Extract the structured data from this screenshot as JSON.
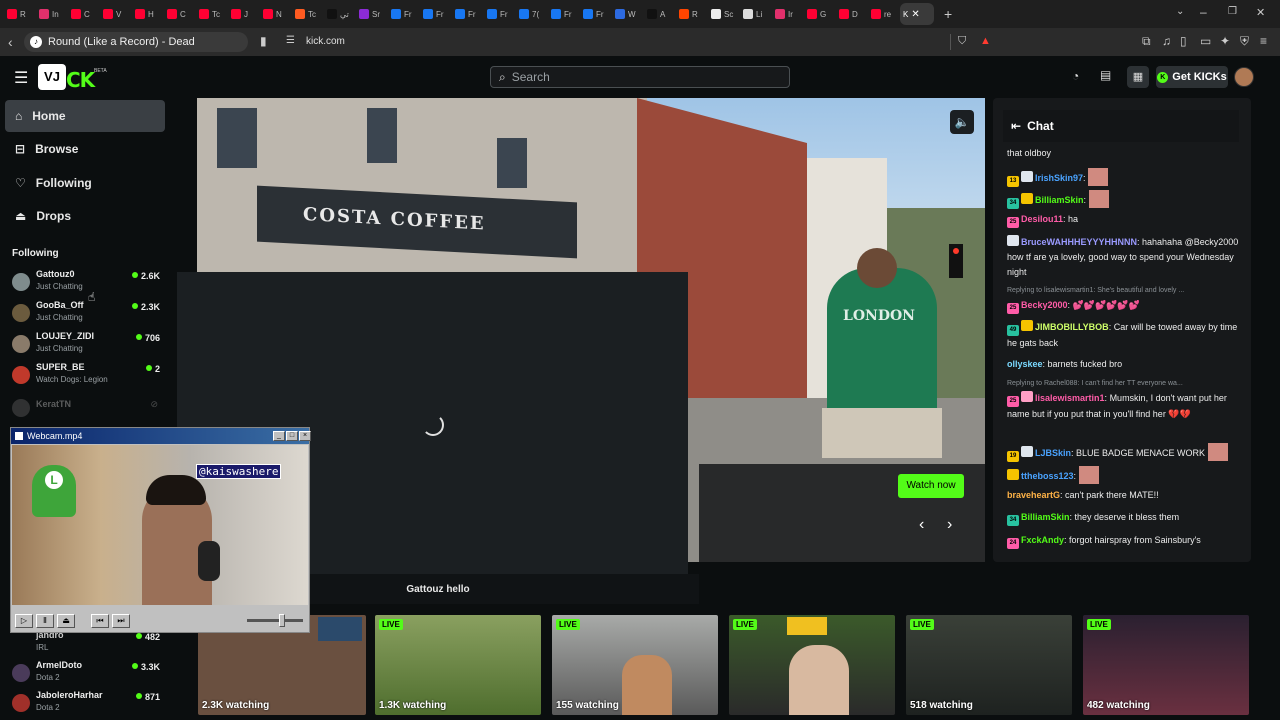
{
  "browser": {
    "tab_title": "Round (Like a Record) - Dead",
    "active_tab_label": "K",
    "url": "kick.com",
    "tabs": [
      {
        "label": "R",
        "color": "#ff0033"
      },
      {
        "label": "In",
        "color": "#e1306c"
      },
      {
        "label": "C",
        "color": "#ff0033"
      },
      {
        "label": "V",
        "color": "#ff0033"
      },
      {
        "label": "H",
        "color": "#ff0033"
      },
      {
        "label": "C",
        "color": "#ff0033"
      },
      {
        "label": "Tc",
        "color": "#ff0033"
      },
      {
        "label": "J",
        "color": "#ff0033"
      },
      {
        "label": "N",
        "color": "#ff0033"
      },
      {
        "label": "Tc",
        "color": "#ff5b21"
      },
      {
        "label": "تي",
        "color": "#111111"
      },
      {
        "label": "Sr",
        "color": "#8c2bd6"
      },
      {
        "label": "Fr",
        "color": "#1877f2"
      },
      {
        "label": "Fr",
        "color": "#1877f2"
      },
      {
        "label": "Fr",
        "color": "#1877f2"
      },
      {
        "label": "Fr",
        "color": "#1877f2"
      },
      {
        "label": "7(",
        "color": "#1877f2"
      },
      {
        "label": "Fr",
        "color": "#1877f2"
      },
      {
        "label": "Fr",
        "color": "#1877f2"
      },
      {
        "label": "W",
        "color": "#2d6ae0"
      },
      {
        "label": "A",
        "color": "#111111"
      },
      {
        "label": "R",
        "color": "#ff4500"
      },
      {
        "label": "Sc",
        "color": "#eeeeee"
      },
      {
        "label": "Li",
        "color": "#dddddd"
      },
      {
        "label": "Ir",
        "color": "#e1306c"
      },
      {
        "label": "G",
        "color": "#ff0033"
      },
      {
        "label": "D",
        "color": "#ff0033"
      },
      {
        "label": "re",
        "color": "#ff0033"
      }
    ]
  },
  "header": {
    "search_placeholder": "Search",
    "get_kicks": "Get KICKs",
    "logo_beta": "BETA"
  },
  "sidebar": {
    "nav": [
      {
        "label": "Home",
        "icon": "home-icon"
      },
      {
        "label": "Browse",
        "icon": "browse-icon"
      },
      {
        "label": "Following",
        "icon": "heart-icon"
      },
      {
        "label": "Drops",
        "icon": "drops-icon"
      }
    ],
    "following_heading": "Following",
    "following": [
      {
        "name": "Gattouz0",
        "category": "Just Chatting",
        "viewers": "2.6K",
        "color": "#7f8c8d"
      },
      {
        "name": "GooBa_Off",
        "category": "Just Chatting",
        "viewers": "2.3K",
        "color": "#6b5b3e"
      },
      {
        "name": "LOUJEY_ZIDI",
        "category": "Just Chatting",
        "viewers": "706",
        "color": "#8a7b6a"
      },
      {
        "name": "SUPER_BE",
        "category": "Watch Dogs: Legion",
        "viewers": "2",
        "color": "#c0392b"
      },
      {
        "name": "KeratTN",
        "category": "",
        "viewers": "",
        "color": "#555555"
      }
    ],
    "bottom_following": [
      {
        "name": "jandro",
        "category": "IRL",
        "viewers": "482"
      },
      {
        "name": "ArmelDoto",
        "category": "Dota 2",
        "viewers": "3.3K"
      },
      {
        "name": "JaboleroHarhar",
        "category": "Dota 2",
        "viewers": "871"
      }
    ]
  },
  "featured": {
    "watch_now": "Watch now",
    "loader_caption": "Gattouz hello",
    "storefront_text": "COSTA COFFEE",
    "shirt_text": "LONDON"
  },
  "chat": {
    "title": "Chat",
    "messages": [
      {
        "user": "",
        "text": "that oldboy",
        "color": "#ffffff"
      },
      {
        "user": "IrishSkin97",
        "text": "",
        "color": "#4aa3ff",
        "badge": "13"
      },
      {
        "user": "BilliamSkin",
        "text": "",
        "color": "#53fc18",
        "badge": "34"
      },
      {
        "user": "Desilou11",
        "text": "ha",
        "color": "#ff5ca8",
        "badge": "25"
      },
      {
        "user": "BruceWAHHHEYYYHHNNN",
        "text": "hahahaha @Becky2000 how tf are ya lovely, good way to spend your Wednesday night",
        "color": "#9a9aff",
        "badge": ""
      },
      {
        "reply": "Replying to lisalewismartin1: She's beautiful and lovely ..."
      },
      {
        "user": "Becky2000",
        "text": "💕💕💕💕💕💕",
        "color": "#ff5ca8",
        "badge": "25"
      },
      {
        "user": "JIMBOBILLYBOB",
        "text": "Car will be towed away by time he gats back",
        "color": "#cfff6a",
        "badge": "49"
      },
      {
        "user": "ollyskee",
        "text": "barnets fucked bro",
        "color": "#7ad9ff",
        "badge": ""
      },
      {
        "reply": "Replying to Rachel088: I can't find her TT everyone wa..."
      },
      {
        "user": "lisalewismartin1",
        "text": "Mumskin, I don't want put her name but if you put that in you'll find her 💔💔",
        "color": "#ff5ca8",
        "badge": "25"
      },
      {
        "user": "LJBSkin",
        "text": "BLUE BADGE MENACE WORK",
        "color": "#4aa3ff",
        "badge": "19"
      },
      {
        "user": "ttheboss123",
        "text": "",
        "color": "#4aa3ff",
        "badge": ""
      },
      {
        "user": "braveheartG",
        "text": "can't park there MATE!!",
        "color": "#ffb347",
        "badge": ""
      },
      {
        "user": "BilliamSkin",
        "text": "they deserve it bless them",
        "color": "#53fc18",
        "badge": "34"
      },
      {
        "user": "FxckAndy",
        "text": "forgot hairspray from Sainsbury's",
        "color": "#53fc18",
        "badge": "24"
      }
    ]
  },
  "thumbnails": [
    {
      "live": "",
      "watching": "2.3K watching",
      "bg": "#6a5040"
    },
    {
      "live": "LIVE",
      "watching": "1.3K watching",
      "bg": "#5a7a3a"
    },
    {
      "live": "LIVE",
      "watching": "155 watching",
      "bg": "#8a8f92"
    },
    {
      "live": "LIVE",
      "watching": "",
      "bg": "#4a5a2a"
    },
    {
      "live": "LIVE",
      "watching": "518 watching",
      "bg": "#2a2e2a"
    },
    {
      "live": "LIVE",
      "watching": "482 watching",
      "bg": "#3a2a3a"
    }
  ],
  "player": {
    "title": "Webcam.mp4",
    "overlay_tag": "@kaiswashere",
    "vj_label": "VJ"
  }
}
